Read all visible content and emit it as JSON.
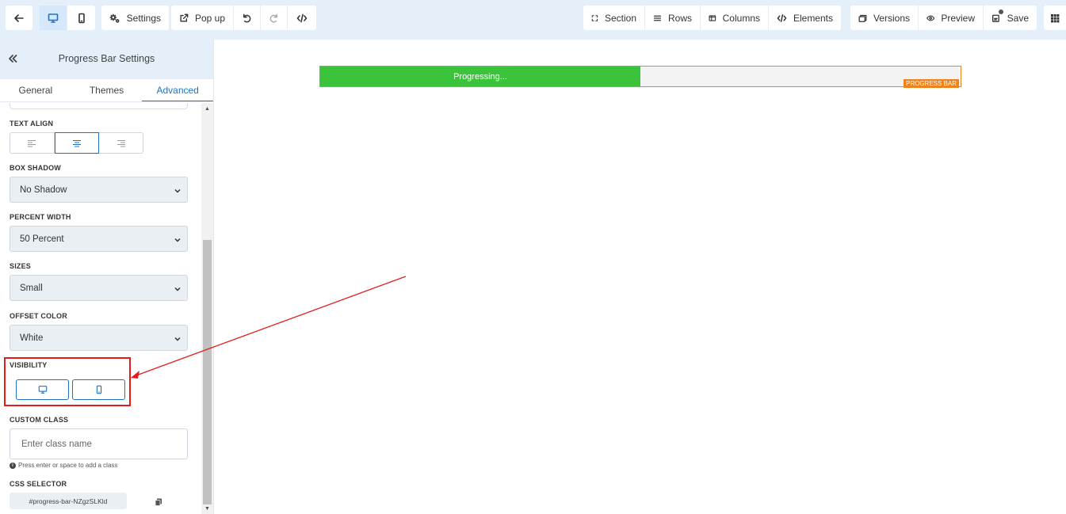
{
  "toolbar": {
    "back_icon": "arrow-left-icon",
    "desktop_icon": "desktop-icon",
    "mobile_icon": "mobile-icon",
    "settings_label": "Settings",
    "popup_label": "Pop up",
    "undo_icon": "undo-icon",
    "redo_icon": "redo-icon",
    "code_icon": "code-icon",
    "section_label": "Section",
    "rows_label": "Rows",
    "columns_label": "Columns",
    "elements_label": "Elements",
    "versions_label": "Versions",
    "preview_label": "Preview",
    "save_label": "Save",
    "apps_icon": "grid-icon"
  },
  "sidebar": {
    "title": "Progress Bar Settings",
    "tabs": [
      {
        "label": "General",
        "active": false
      },
      {
        "label": "Themes",
        "active": false
      },
      {
        "label": "Advanced",
        "active": true
      }
    ],
    "text_align": {
      "label": "TEXT ALIGN",
      "options": [
        "left",
        "center",
        "right"
      ],
      "selected": "center"
    },
    "box_shadow": {
      "label": "BOX SHADOW",
      "value": "No Shadow"
    },
    "percent_width": {
      "label": "PERCENT WIDTH",
      "value": "50 Percent"
    },
    "sizes": {
      "label": "SIZES",
      "value": "Small"
    },
    "offset_color": {
      "label": "OFFSET COLOR",
      "value": "White"
    },
    "visibility": {
      "label": "VISIBILITY"
    },
    "custom_class": {
      "label": "CUSTOM CLASS",
      "placeholder": "Enter class name",
      "hint": "Press enter or space to add a class"
    },
    "css_selector": {
      "label": "CSS SELECTOR",
      "value": "#progress-bar-NZgzSLKld"
    }
  },
  "canvas": {
    "progress_bar": {
      "text": "Progressing...",
      "percent": 50,
      "tag": "PROGRESS BAR",
      "fill_color": "#3bc33b",
      "outline_color": "#f0821e"
    }
  },
  "colors": {
    "accent": "#1e73be",
    "annotation": "#e01c1c",
    "toolbar_bg": "#e4effa"
  }
}
